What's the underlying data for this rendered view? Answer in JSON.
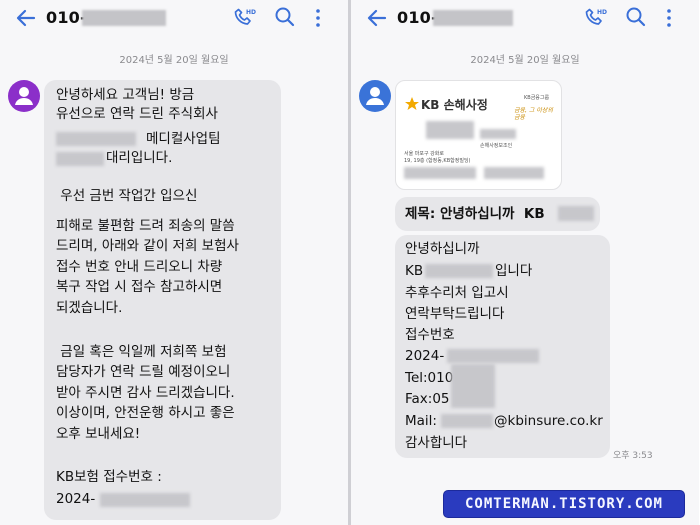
{
  "left": {
    "title_prefix": "010-",
    "date_divider": "2024년 5월 20일 월요일",
    "message": {
      "line1": "안녕하세요 고객님! 방금",
      "line2": "유선으로 연락 드린 주식회사",
      "line3": "메디컬사업팀",
      "line4": "대리입니다.",
      "line5": " 우선 금번 작업간 입으신",
      "line6": "피해로 불편함 드려 죄송의 말씀",
      "line7": "드리며, 아래와 같이 저희 보험사",
      "line8": "접수 번호 안내 드리오니 차량",
      "line9": "복구 작업 시 접수 참고하시면",
      "line10": "되겠습니다.",
      "line11": " 금일 혹은 익일께 저희쪽 보험",
      "line12": "담당자가 연락 드릴 예정이오니",
      "line13": "받아 주시면 감사 드리겠습니다.",
      "line14": "이상이며, 안전운행 하시고 좋은",
      "line15": "오후 보내세요!",
      "line16": "KB보험 접수번호 :",
      "line17": "2024-"
    }
  },
  "right": {
    "title_prefix": "010-",
    "date_divider": "2024년 5월 20일 월요일",
    "card": {
      "logo_text": "KB 손해사정",
      "group_text": "KB금융그룹",
      "slogan": "금융, 그 이상의 금융",
      "dept": "손해사정보조인",
      "address1": "서울 마포구 강화로",
      "address2": "19, 19층 (합정동,KB합정빌딩)"
    },
    "subject": "제목: 안녕하십니까  KB",
    "message": {
      "line1": "안녕하십니까",
      "line2": "KB",
      "line2b": "입니다",
      "line3": "추후수리처 입고시",
      "line4": "연락부탁드립니다",
      "line5": "접수번호",
      "line6": "2024-",
      "line7": "Tel:010",
      "line8": "Fax:05",
      "line9a": "Mail:",
      "line9b": "@kbinsure.co.kr",
      "line10": "감사합니다"
    },
    "time": "오후 3:53"
  },
  "watermark": "COMTERMAN.TISTORY.COM",
  "colors": {
    "left_avatar": "#8b2fc9",
    "right_avatar": "#3a73d8",
    "bubble": "#e6e6e9",
    "kb_orange": "#f2a900",
    "watermark": "#2a3bbf"
  }
}
